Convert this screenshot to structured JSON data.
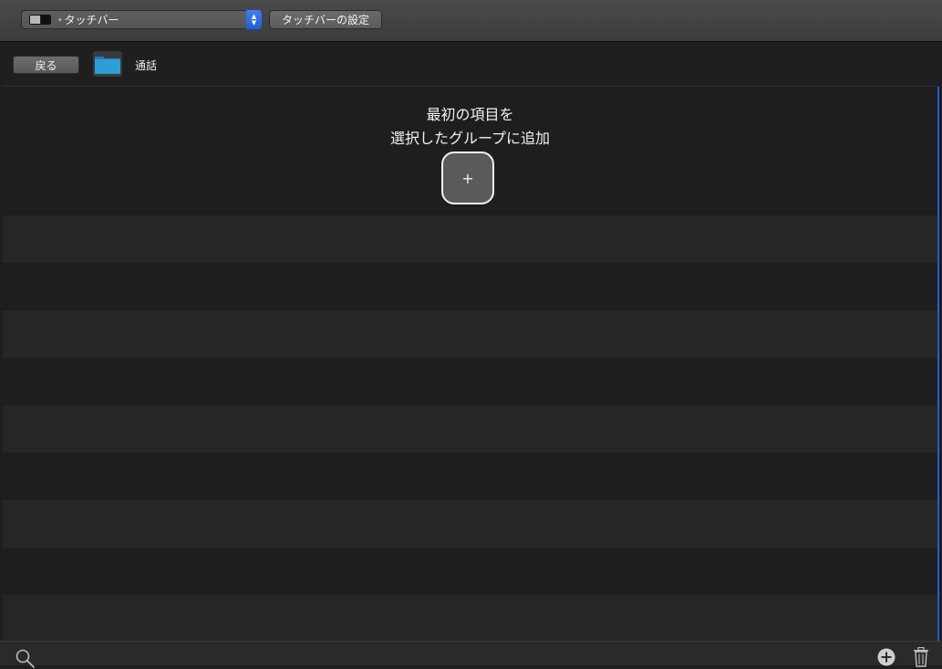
{
  "toolbar": {
    "preset_popup_label": "タッチバー",
    "settings_button_label": "タッチバーの設定"
  },
  "navbar": {
    "back_label": "戻る",
    "folder_title": "通話"
  },
  "main": {
    "empty_line1": "最初の項目を",
    "empty_line2": "選択したグループに追加",
    "add_button_label": "+"
  },
  "colors": {
    "accent": "#1f5fd8",
    "folder": "#2a9fd8"
  },
  "icons": {
    "preset": "touch-bar-icon",
    "folder": "folder-icon",
    "search": "search-icon",
    "add": "plus-circle-icon",
    "delete": "trash-icon"
  }
}
